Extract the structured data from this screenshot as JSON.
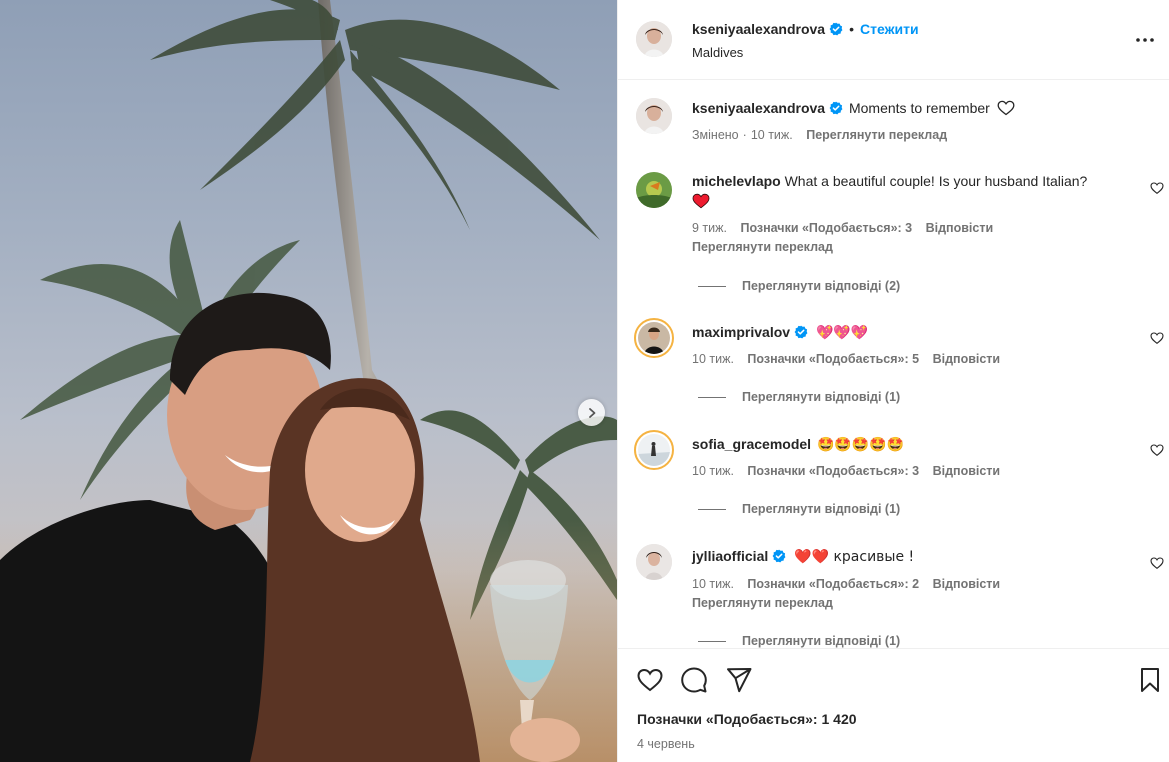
{
  "post": {
    "username": "kseniyaalexandrova",
    "follow_label": "Стежити",
    "separator": "•",
    "location": "Maldives"
  },
  "caption": {
    "username": "kseniyaalexandrova",
    "text": "Moments to remember",
    "edited": "Змінено",
    "time": "10 тиж.",
    "translate": "Переглянути переклад"
  },
  "comments": [
    {
      "username": "michelevlapo",
      "text": "What a beautiful couple! Is your husband Italian?",
      "emoji": "❤️",
      "time": "9 тиж.",
      "likes": "Позначки «Подобається»: 3",
      "reply": "Відповісти",
      "translate": "Переглянути переклад",
      "view_replies": "Переглянути відповіді (2)"
    },
    {
      "username": "maximprivalov",
      "text": "💖💖💖",
      "time": "10 тиж.",
      "likes": "Позначки «Подобається»: 5",
      "reply": "Відповісти",
      "view_replies": "Переглянути відповіді (1)"
    },
    {
      "username": "sofia_gracemodel",
      "text": "🤩🤩🤩🤩🤩",
      "time": "10 тиж.",
      "likes": "Позначки «Подобається»: 3",
      "reply": "Відповісти",
      "view_replies": "Переглянути відповіді (1)"
    },
    {
      "username": "jylliaofficial",
      "text": "❤️❤️ красивые !",
      "time": "10 тиж.",
      "likes": "Позначки «Подобається»: 2",
      "reply": "Відповісти",
      "translate": "Переглянути переклад",
      "view_replies": "Переглянути відповіді (1)"
    }
  ],
  "footer": {
    "likes": "Позначки «Подобається»: 1 420",
    "date": "4 червень"
  },
  "icons": {
    "verified": "verified-badge-icon",
    "more": "more-options-icon",
    "like": "heart-icon",
    "comment": "comment-icon",
    "share": "share-icon",
    "save": "bookmark-icon",
    "next": "chevron-right-icon"
  },
  "colors": {
    "accent": "#0095f6",
    "verified": "#0095f6",
    "secondary_text": "#737373",
    "heart_red": "#ed1b2f"
  }
}
